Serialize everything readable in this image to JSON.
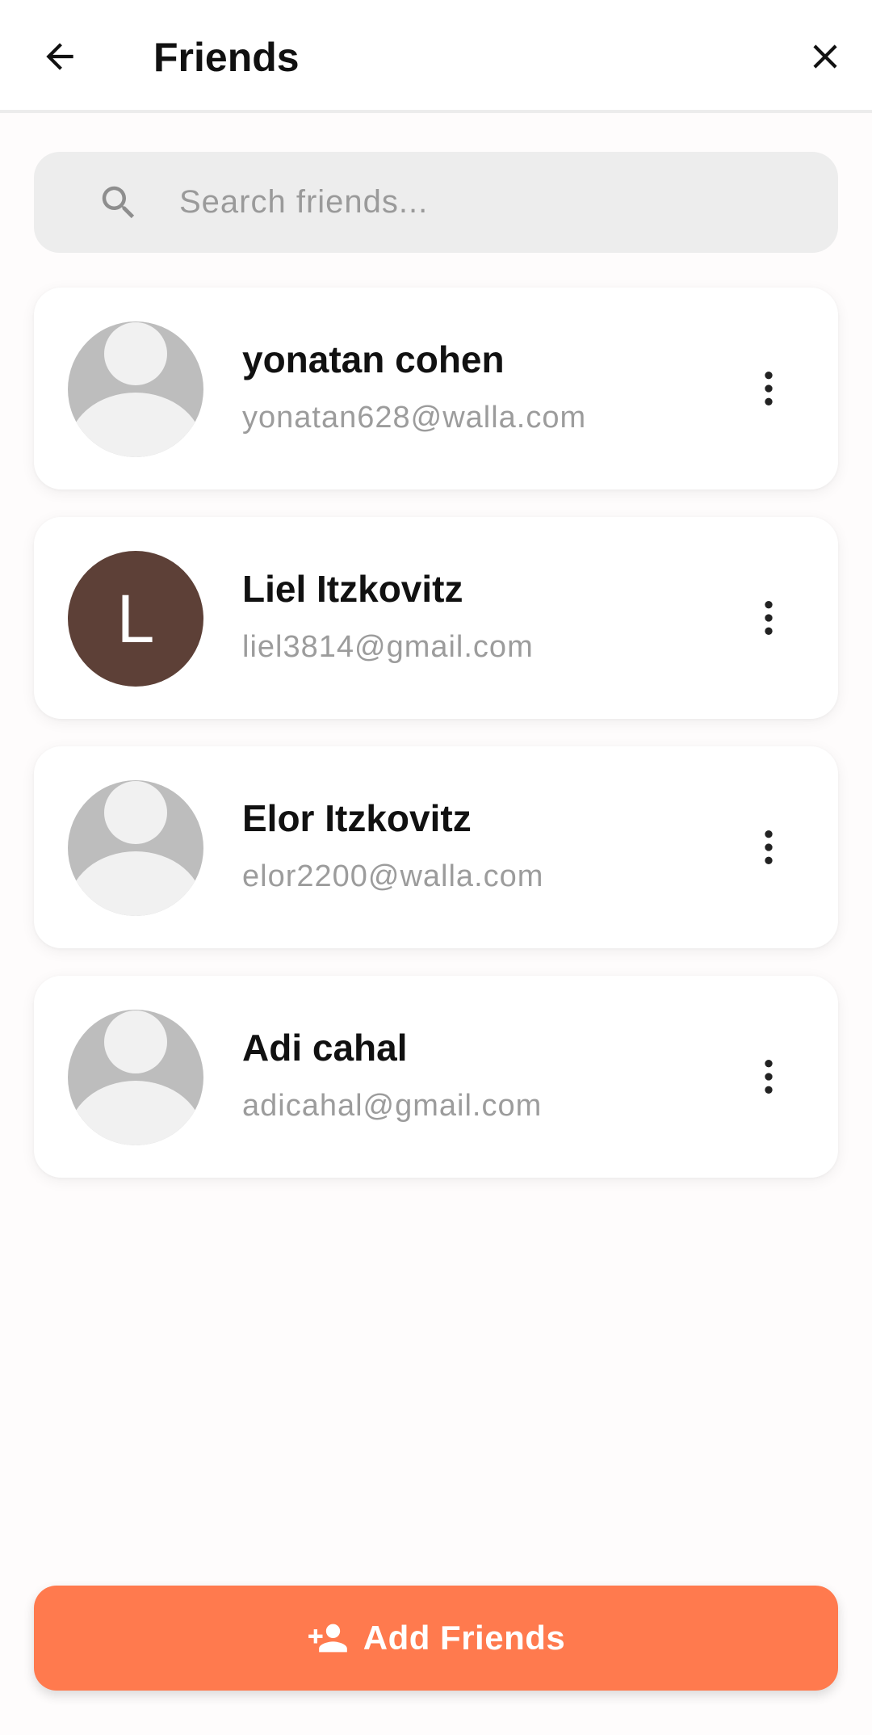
{
  "header": {
    "title": "Friends",
    "back_icon": "arrow-left-icon",
    "close_icon": "close-icon"
  },
  "search": {
    "placeholder": "Search friends...",
    "value": "",
    "icon": "search-icon"
  },
  "friends": [
    {
      "name": "yonatan cohen",
      "email": "yonatan628@walla.com",
      "avatar": "default-avatar-icon",
      "initial": ""
    },
    {
      "name": "Liel Itzkovitz",
      "email": "liel3814@gmail.com",
      "avatar": "letter",
      "initial": "L",
      "avatar_color": "#5d4037"
    },
    {
      "name": "Elor Itzkovitz",
      "email": "elor2200@walla.com",
      "avatar": "default-avatar-icon",
      "initial": ""
    },
    {
      "name": "Adi cahal",
      "email": "adicahal@gmail.com",
      "avatar": "default-avatar-icon",
      "initial": ""
    }
  ],
  "add_button": {
    "label": "Add Friends",
    "icon": "person-add-icon"
  },
  "colors": {
    "accent": "#ff7a4e",
    "avatar_letter_bg": "#5d4037",
    "avatar_default_bg": "#bdbdbd",
    "avatar_default_fg": "#f1f1f1",
    "search_bg": "#ededed"
  }
}
